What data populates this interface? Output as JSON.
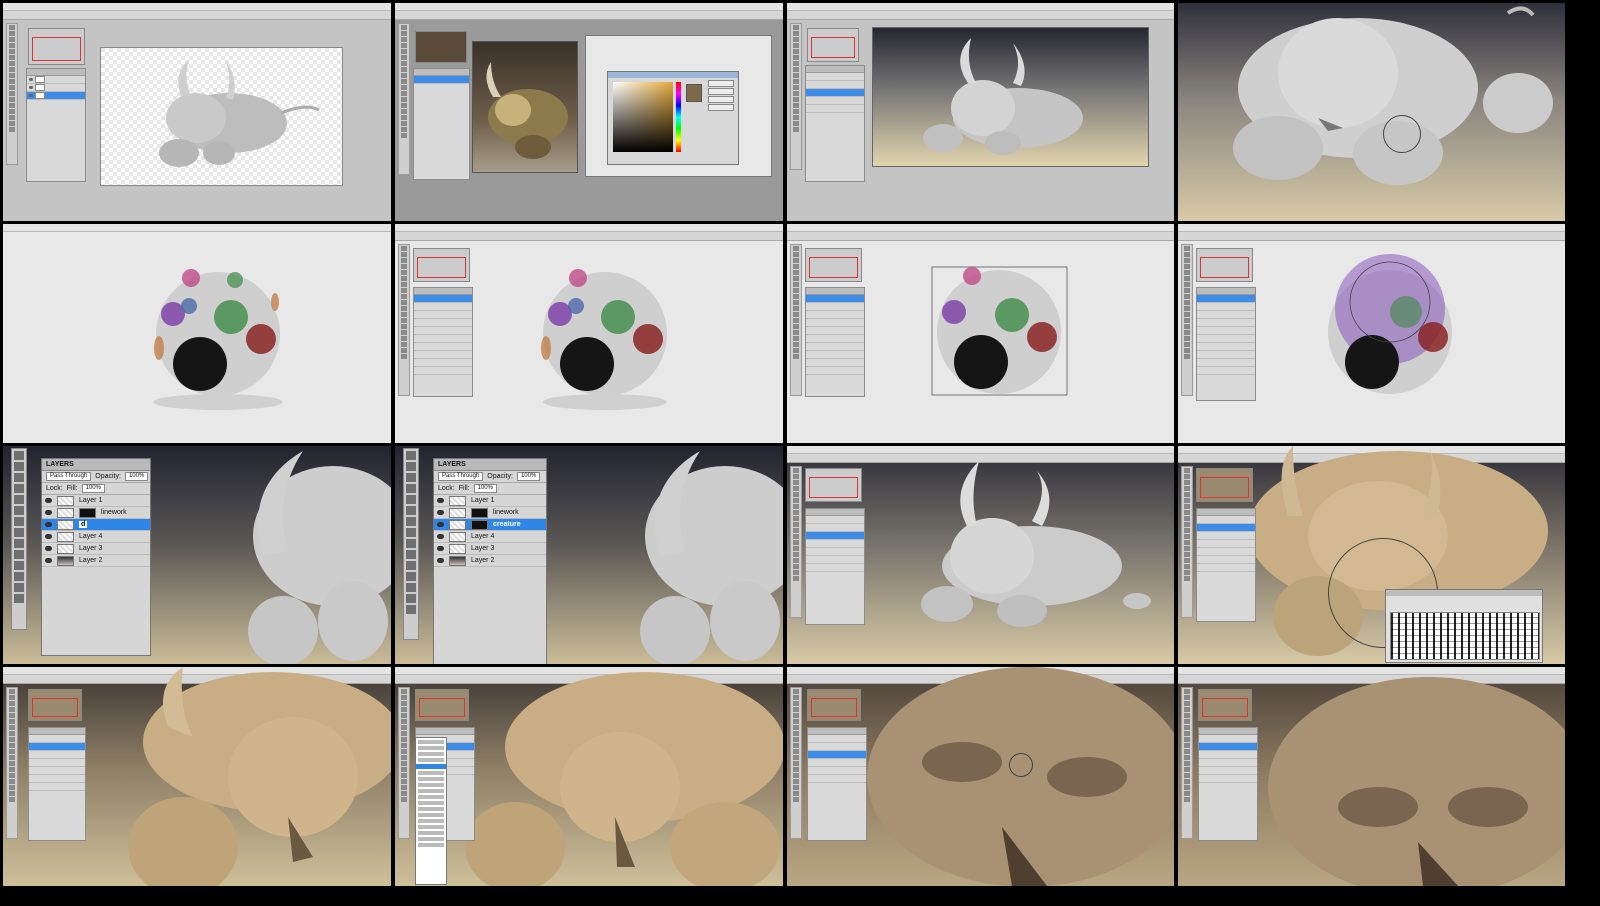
{
  "layers_panel": {
    "title": "LAYERS",
    "blend_mode": "Pass Through",
    "opacity_label": "Opacity:",
    "opacity_value": "100%",
    "lock_label": "Lock:",
    "fill_label": "Fill:",
    "fill_value": "100%",
    "layers_a": [
      "Layer 1",
      "linework",
      "Layer 4",
      "Layer 3",
      "Layer 2"
    ],
    "layers_b": [
      "Layer 1",
      "linework",
      "creature",
      "Layer 4",
      "Layer 3",
      "Layer 2"
    ],
    "group_label_a": "d",
    "group_label_b": "creature"
  },
  "colors": {
    "selection_blue": "#2f86e6",
    "ui_gray": "#d2d2d2",
    "creature_gray": "#c8c8c8",
    "creature_tan": "#cdb48e",
    "background_dark": "#2a2a33",
    "background_tan": "#d9caa4"
  },
  "icons": [
    "eye-icon",
    "layer-mask-icon",
    "brush-cursor-icon",
    "move-tool-icon",
    "color-picker-icon"
  ]
}
